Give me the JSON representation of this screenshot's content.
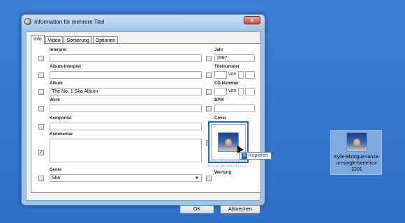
{
  "window": {
    "title": "Information für mehrere Titel",
    "close_label": "x"
  },
  "tabs": [
    {
      "label": "Info"
    },
    {
      "label": "Video"
    },
    {
      "label": "Sortierung"
    },
    {
      "label": "Optionen"
    }
  ],
  "fields": {
    "interpret": {
      "label": "Interpret",
      "value": ""
    },
    "album_interpret": {
      "label": "Album-Interpret",
      "value": ""
    },
    "album": {
      "label": "Album",
      "value": "The No. 1 Ska Album"
    },
    "werk": {
      "label": "Werk",
      "value": ""
    },
    "komponist": {
      "label": "Komponist",
      "value": ""
    },
    "kommentar": {
      "label": "Kommentar",
      "value": "",
      "checked": true
    },
    "genre": {
      "label": "Genre",
      "value": "Ska"
    },
    "jahr": {
      "label": "Jahr",
      "value": "1997"
    },
    "titelnummer": {
      "label": "Titelnummer",
      "von": "von"
    },
    "cd_nummer": {
      "label": "CD-Nummer",
      "von": "von"
    },
    "bpm": {
      "label": "BPM",
      "value": ""
    },
    "cover": {
      "label": "Cover",
      "checked": true
    },
    "wertung": {
      "label": "Wertung"
    }
  },
  "drag_tooltip": {
    "label": "Kopieren"
  },
  "drag_ghost": {
    "line1": "Kylie-Minogue-lanza-",
    "line2": "un-single-benefico-2",
    "line3": "01"
  },
  "buttons": {
    "ok": "OK",
    "cancel": "Abbrechen"
  },
  "desktop_icon": {
    "label": "Kylie-Minogue-lanza-un-single-benefico-2201"
  },
  "colors": {
    "desktop": "#3b7fd6",
    "accent": "#1b66c9"
  }
}
